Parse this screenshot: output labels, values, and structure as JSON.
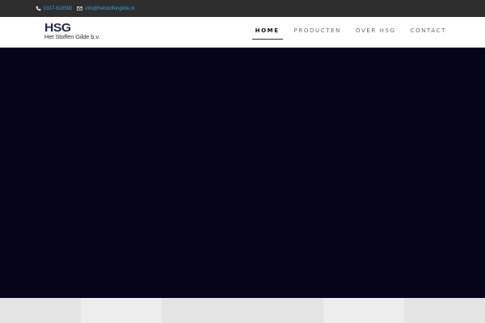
{
  "topbar": {
    "phone": "0317-613592",
    "email": "info@hetstoffengilde.nl",
    "phone_icon": "phone-icon",
    "email_icon": "envelope-icon",
    "link_color": "#3aa0dc",
    "background": "#2e2e2e"
  },
  "logo": {
    "mark": "HSG",
    "subtitle": "Het Stoffen Gilde b.v.",
    "color": "#1f2a4f"
  },
  "nav": {
    "items": [
      {
        "label": "HOME",
        "active": true
      },
      {
        "label": "PRODUCTEN",
        "active": false
      },
      {
        "label": "OVER HSG",
        "active": false
      },
      {
        "label": "CONTACT",
        "active": false
      }
    ]
  },
  "hero": {
    "background": "#050419"
  },
  "tiles": {
    "colors": [
      "#e4e4e4",
      "#ededed",
      "#e4e4e4",
      "#e4e4e4",
      "#ededed",
      "#e4e4e4"
    ]
  }
}
